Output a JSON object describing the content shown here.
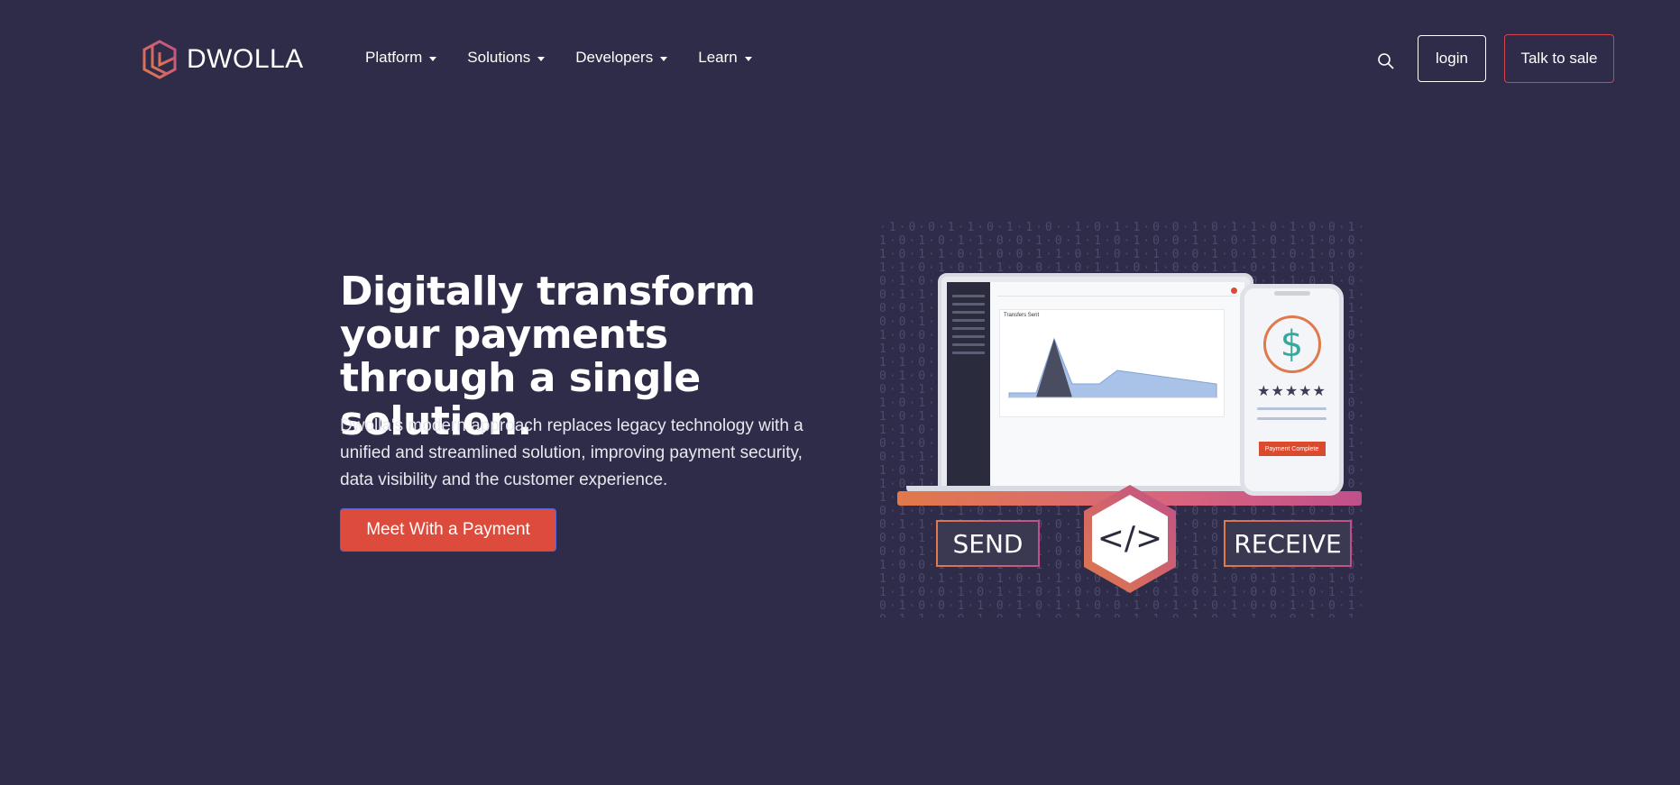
{
  "brand": {
    "name": "DWOLLA"
  },
  "nav": {
    "items": [
      {
        "label": "Platform"
      },
      {
        "label": "Solutions"
      },
      {
        "label": "Developers"
      },
      {
        "label": "Learn"
      }
    ],
    "login_label": "login",
    "sales_label": "Talk to sale",
    "search_icon": "search-icon"
  },
  "hero": {
    "title": "Digitally transform your payments through a single solution.",
    "description": "Dwolla's modern approach replaces legacy technology with a unified and streamlined solution, improving payment security, data visibility and the customer experience.",
    "cta_label": "Meet With a Payment"
  },
  "illustration": {
    "dashboard_title": "Transfers Sent",
    "payment_button": "Payment Complete",
    "stars": "★★★★★",
    "dollar": "$",
    "send_label": "SEND",
    "receive_label": "RECEIVE",
    "code_symbol": "</>"
  },
  "colors": {
    "background": "#2e2c48",
    "accent_red": "#dd4b3c",
    "accent_orange": "#e0794b",
    "accent_pink": "#c0508a"
  }
}
